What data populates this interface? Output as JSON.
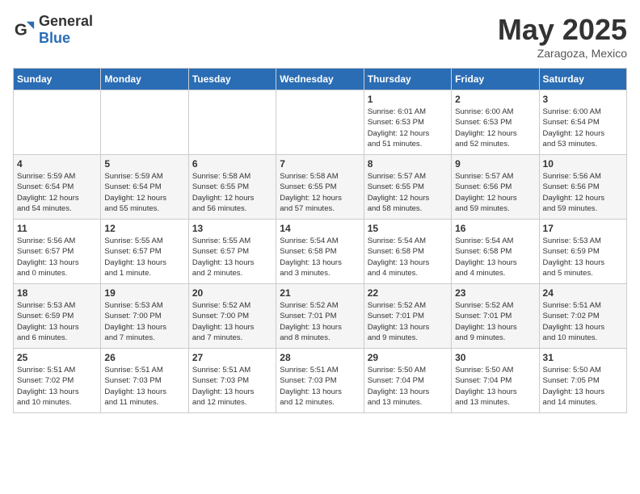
{
  "logo": {
    "general": "General",
    "blue": "Blue"
  },
  "title": {
    "month_year": "May 2025",
    "location": "Zaragoza, Mexico"
  },
  "headers": [
    "Sunday",
    "Monday",
    "Tuesday",
    "Wednesday",
    "Thursday",
    "Friday",
    "Saturday"
  ],
  "weeks": [
    [
      {
        "day": "",
        "info": ""
      },
      {
        "day": "",
        "info": ""
      },
      {
        "day": "",
        "info": ""
      },
      {
        "day": "",
        "info": ""
      },
      {
        "day": "1",
        "info": "Sunrise: 6:01 AM\nSunset: 6:53 PM\nDaylight: 12 hours\nand 51 minutes."
      },
      {
        "day": "2",
        "info": "Sunrise: 6:00 AM\nSunset: 6:53 PM\nDaylight: 12 hours\nand 52 minutes."
      },
      {
        "day": "3",
        "info": "Sunrise: 6:00 AM\nSunset: 6:54 PM\nDaylight: 12 hours\nand 53 minutes."
      }
    ],
    [
      {
        "day": "4",
        "info": "Sunrise: 5:59 AM\nSunset: 6:54 PM\nDaylight: 12 hours\nand 54 minutes."
      },
      {
        "day": "5",
        "info": "Sunrise: 5:59 AM\nSunset: 6:54 PM\nDaylight: 12 hours\nand 55 minutes."
      },
      {
        "day": "6",
        "info": "Sunrise: 5:58 AM\nSunset: 6:55 PM\nDaylight: 12 hours\nand 56 minutes."
      },
      {
        "day": "7",
        "info": "Sunrise: 5:58 AM\nSunset: 6:55 PM\nDaylight: 12 hours\nand 57 minutes."
      },
      {
        "day": "8",
        "info": "Sunrise: 5:57 AM\nSunset: 6:55 PM\nDaylight: 12 hours\nand 58 minutes."
      },
      {
        "day": "9",
        "info": "Sunrise: 5:57 AM\nSunset: 6:56 PM\nDaylight: 12 hours\nand 59 minutes."
      },
      {
        "day": "10",
        "info": "Sunrise: 5:56 AM\nSunset: 6:56 PM\nDaylight: 12 hours\nand 59 minutes."
      }
    ],
    [
      {
        "day": "11",
        "info": "Sunrise: 5:56 AM\nSunset: 6:57 PM\nDaylight: 13 hours\nand 0 minutes."
      },
      {
        "day": "12",
        "info": "Sunrise: 5:55 AM\nSunset: 6:57 PM\nDaylight: 13 hours\nand 1 minute."
      },
      {
        "day": "13",
        "info": "Sunrise: 5:55 AM\nSunset: 6:57 PM\nDaylight: 13 hours\nand 2 minutes."
      },
      {
        "day": "14",
        "info": "Sunrise: 5:54 AM\nSunset: 6:58 PM\nDaylight: 13 hours\nand 3 minutes."
      },
      {
        "day": "15",
        "info": "Sunrise: 5:54 AM\nSunset: 6:58 PM\nDaylight: 13 hours\nand 4 minutes."
      },
      {
        "day": "16",
        "info": "Sunrise: 5:54 AM\nSunset: 6:58 PM\nDaylight: 13 hours\nand 4 minutes."
      },
      {
        "day": "17",
        "info": "Sunrise: 5:53 AM\nSunset: 6:59 PM\nDaylight: 13 hours\nand 5 minutes."
      }
    ],
    [
      {
        "day": "18",
        "info": "Sunrise: 5:53 AM\nSunset: 6:59 PM\nDaylight: 13 hours\nand 6 minutes."
      },
      {
        "day": "19",
        "info": "Sunrise: 5:53 AM\nSunset: 7:00 PM\nDaylight: 13 hours\nand 7 minutes."
      },
      {
        "day": "20",
        "info": "Sunrise: 5:52 AM\nSunset: 7:00 PM\nDaylight: 13 hours\nand 7 minutes."
      },
      {
        "day": "21",
        "info": "Sunrise: 5:52 AM\nSunset: 7:01 PM\nDaylight: 13 hours\nand 8 minutes."
      },
      {
        "day": "22",
        "info": "Sunrise: 5:52 AM\nSunset: 7:01 PM\nDaylight: 13 hours\nand 9 minutes."
      },
      {
        "day": "23",
        "info": "Sunrise: 5:52 AM\nSunset: 7:01 PM\nDaylight: 13 hours\nand 9 minutes."
      },
      {
        "day": "24",
        "info": "Sunrise: 5:51 AM\nSunset: 7:02 PM\nDaylight: 13 hours\nand 10 minutes."
      }
    ],
    [
      {
        "day": "25",
        "info": "Sunrise: 5:51 AM\nSunset: 7:02 PM\nDaylight: 13 hours\nand 10 minutes."
      },
      {
        "day": "26",
        "info": "Sunrise: 5:51 AM\nSunset: 7:03 PM\nDaylight: 13 hours\nand 11 minutes."
      },
      {
        "day": "27",
        "info": "Sunrise: 5:51 AM\nSunset: 7:03 PM\nDaylight: 13 hours\nand 12 minutes."
      },
      {
        "day": "28",
        "info": "Sunrise: 5:51 AM\nSunset: 7:03 PM\nDaylight: 13 hours\nand 12 minutes."
      },
      {
        "day": "29",
        "info": "Sunrise: 5:50 AM\nSunset: 7:04 PM\nDaylight: 13 hours\nand 13 minutes."
      },
      {
        "day": "30",
        "info": "Sunrise: 5:50 AM\nSunset: 7:04 PM\nDaylight: 13 hours\nand 13 minutes."
      },
      {
        "day": "31",
        "info": "Sunrise: 5:50 AM\nSunset: 7:05 PM\nDaylight: 13 hours\nand 14 minutes."
      }
    ]
  ]
}
